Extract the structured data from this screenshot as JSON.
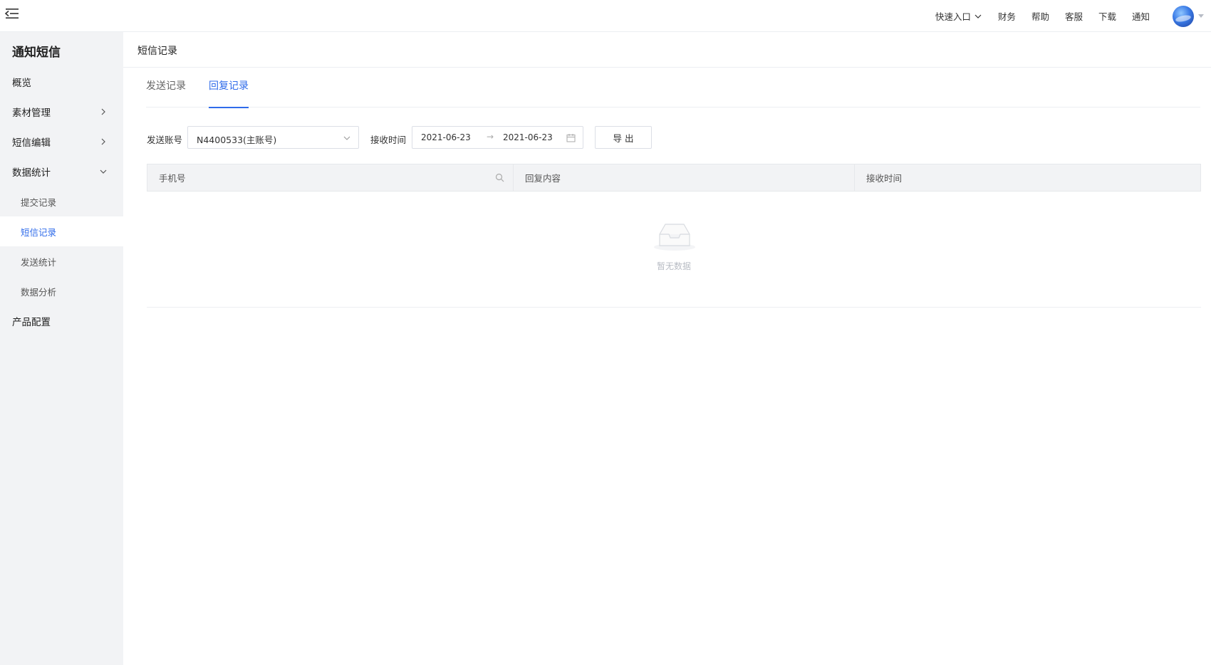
{
  "topbar": {
    "links": [
      "快速入口",
      "财务",
      "帮助",
      "客服",
      "下载",
      "通知"
    ]
  },
  "sidebar": {
    "title": "通知短信",
    "items": [
      {
        "label": "概览"
      },
      {
        "label": "素材管理"
      },
      {
        "label": "短信编辑"
      },
      {
        "label": "数据统计"
      }
    ],
    "subitems": [
      {
        "label": "提交记录"
      },
      {
        "label": "短信记录",
        "active": true
      },
      {
        "label": "发送统计"
      },
      {
        "label": "数据分析"
      }
    ],
    "bottom_item": {
      "label": "产品配置"
    }
  },
  "main": {
    "page_title": "短信记录",
    "tabs": [
      {
        "label": "发送记录"
      },
      {
        "label": "回复记录",
        "active": true
      }
    ],
    "filters": {
      "account_label": "发送账号",
      "account_value": "N4400533(主账号)",
      "time_label": "接收时间",
      "start_date": "2021-06-23",
      "range_sep": "→",
      "end_date": "2021-06-23",
      "export_label": "导出"
    },
    "table": {
      "columns": [
        "手机号",
        "回复内容",
        "接收时间"
      ],
      "empty_text": "暂无数据"
    }
  },
  "colors": {
    "accent": "#2f6bea",
    "sidebar_bg": "#f2f3f5"
  }
}
